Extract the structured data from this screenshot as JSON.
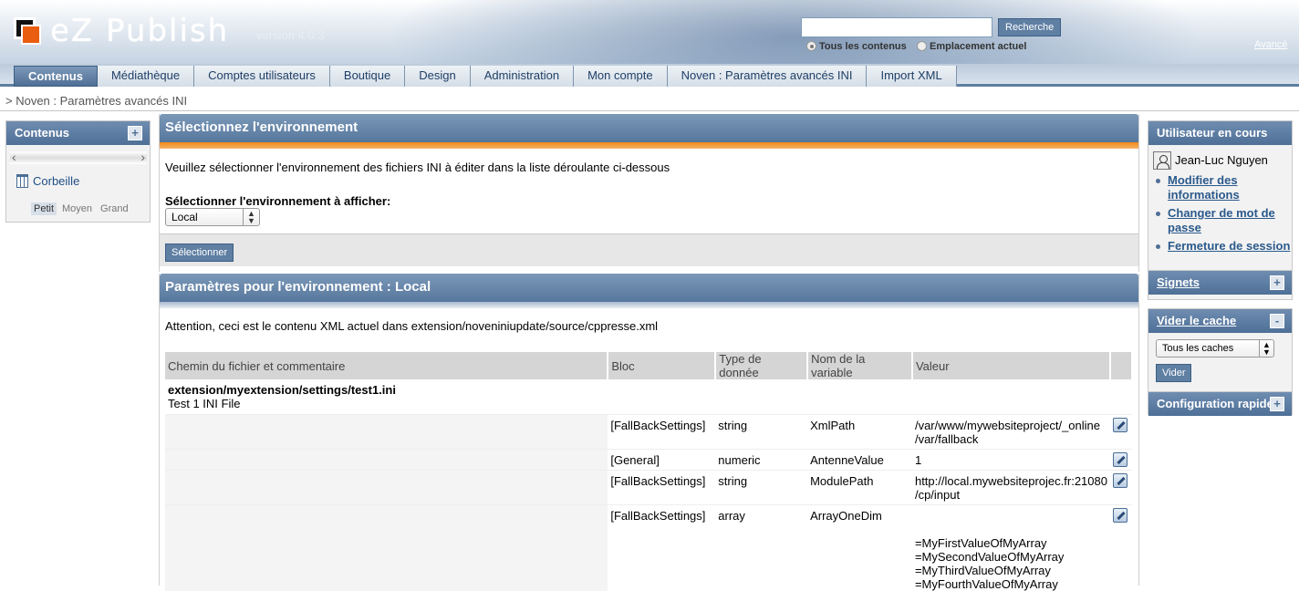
{
  "header": {
    "logo_text": "eZ Publish",
    "version": "version 4.0.3",
    "search_placeholder": "",
    "search_button": "Recherche",
    "radio_all": "Tous les contenus",
    "radio_current": "Emplacement actuel",
    "advanced": "Avancé"
  },
  "tabs": [
    {
      "label": "Contenus",
      "active": true
    },
    {
      "label": "Médiathèque"
    },
    {
      "label": "Comptes utilisateurs"
    },
    {
      "label": "Boutique"
    },
    {
      "label": "Design"
    },
    {
      "label": "Administration"
    },
    {
      "label": "Mon compte"
    },
    {
      "label": "Noven : Paramètres avancés INI"
    },
    {
      "label": "Import XML"
    }
  ],
  "path": "> Noven : Paramètres avancés INI",
  "left": {
    "title": "Contenus",
    "trash": "Corbeille",
    "sizes": [
      "Petit",
      "Moyen",
      "Grand"
    ]
  },
  "panel1": {
    "title": "Sélectionnez l'environnement",
    "text": "Veuillez sélectionner l'environnement des fichiers INI à éditer dans la liste déroulante ci-dessous",
    "select_label": "Sélectionner l'environnement à afficher:",
    "selected_env": "Local",
    "button": "Sélectionner"
  },
  "panel2": {
    "title": "Paramètres pour l'environnement : Local",
    "text": "Attention, ceci est le contenu XML actuel dans extension/noveniniupdate/source/cppresse.xml",
    "columns": [
      "Chemin du fichier et commentaire",
      "Bloc",
      "Type de donnée",
      "Nom de la variable",
      "Valeur",
      ""
    ],
    "file_path": "extension/myextension/settings/test1.ini",
    "file_comment": "Test 1 INI File",
    "rows": [
      {
        "bloc": "[FallBackSettings]",
        "type": "string",
        "name": "XmlPath",
        "value1": "/var/www/mywebsiteproject/_online",
        "value2": "/var/fallback"
      },
      {
        "bloc": "[General]",
        "type": "numeric",
        "name": "AntenneValue",
        "value1": "1",
        "value2": ""
      },
      {
        "bloc": "[FallBackSettings]",
        "type": "string",
        "name": "ModulePath",
        "value1": "http://local.mywebsiteprojec.fr:21080",
        "value2": "/cp/input"
      },
      {
        "bloc": "[FallBackSettings]",
        "type": "array",
        "name": "ArrayOneDim",
        "value1": "",
        "value2": ""
      }
    ],
    "array_values": [
      "=MyFirstValueOfMyArray",
      "=MySecondValueOfMyArray",
      "=MyThirdValueOfMyArray",
      "=MyFourthValueOfMyArray"
    ]
  },
  "right": {
    "user_title": "Utilisateur en cours",
    "user_name": "Jean-Luc Nguyen",
    "links": [
      "Modifier des informations",
      "Changer de mot de passe",
      "Fermeture de session"
    ],
    "bookmarks": "Signets",
    "cache_title": "Vider le cache",
    "cache_select": "Tous les caches",
    "cache_button": "Vider",
    "quick_config": "Configuration rapide"
  }
}
